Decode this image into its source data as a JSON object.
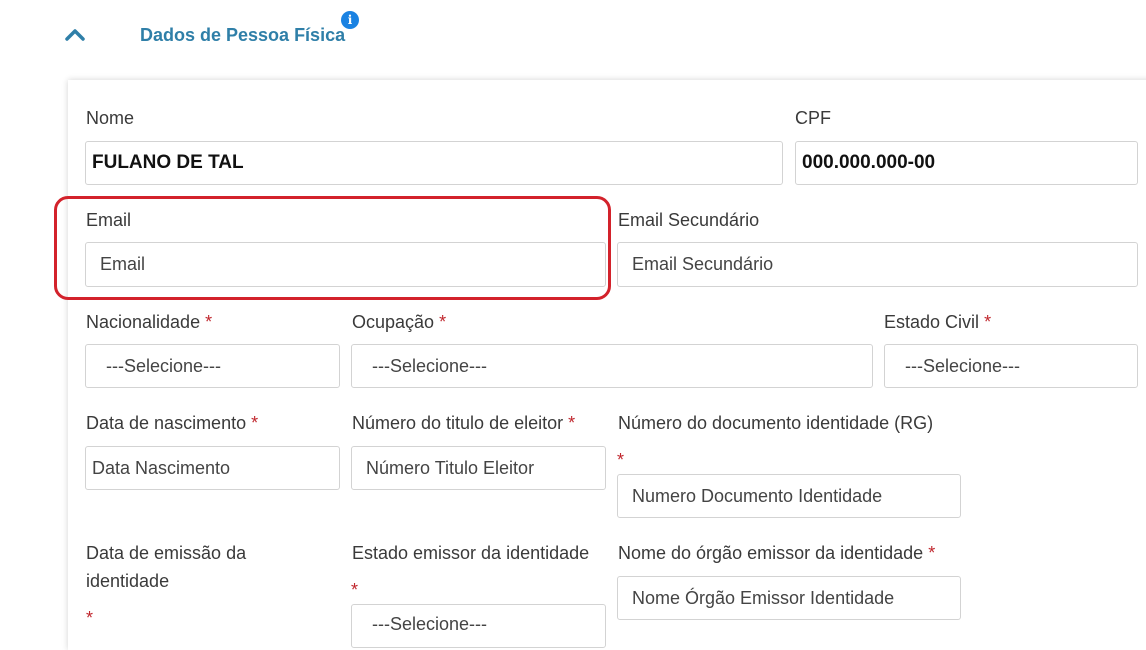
{
  "section": {
    "title": "Dados de Pessoa Física",
    "info_icon": "i"
  },
  "form": {
    "nome": {
      "label": "Nome",
      "value": "FULANO DE TAL"
    },
    "cpf": {
      "label": "CPF",
      "value": "000.000.000-00"
    },
    "email": {
      "label": "Email",
      "placeholder": "Email"
    },
    "email_secundario": {
      "label": "Email Secundário",
      "placeholder": "Email Secundário"
    },
    "nacionalidade": {
      "label": "Nacionalidade",
      "value": "---Selecione---"
    },
    "ocupacao": {
      "label": "Ocupação",
      "value": "---Selecione---"
    },
    "estado_civil": {
      "label": "Estado Civil",
      "value": "---Selecione---"
    },
    "data_nascimento": {
      "label": "Data de nascimento",
      "placeholder": "Data Nascimento"
    },
    "titulo_eleitor": {
      "label": "Número do titulo de eleitor",
      "placeholder": "Número Titulo Eleitor"
    },
    "documento_identidade": {
      "label": "Número do documento identidade (RG)",
      "placeholder": "Numero Documento Identidade"
    },
    "data_emissao": {
      "label_line1": "Data de emissão da",
      "label_line2": "identidade"
    },
    "estado_emissor": {
      "label": "Estado emissor da identidade",
      "value": "---Selecione---"
    },
    "orgao_emissor": {
      "label": "Nome do órgão emissor da identidade",
      "placeholder": "Nome Órgão Emissor Identidade"
    },
    "required_mark": "*"
  },
  "colors": {
    "accent": "#2f7fa8",
    "required": "#c0262d",
    "highlight": "#d3222b",
    "info": "#1a82e2"
  }
}
